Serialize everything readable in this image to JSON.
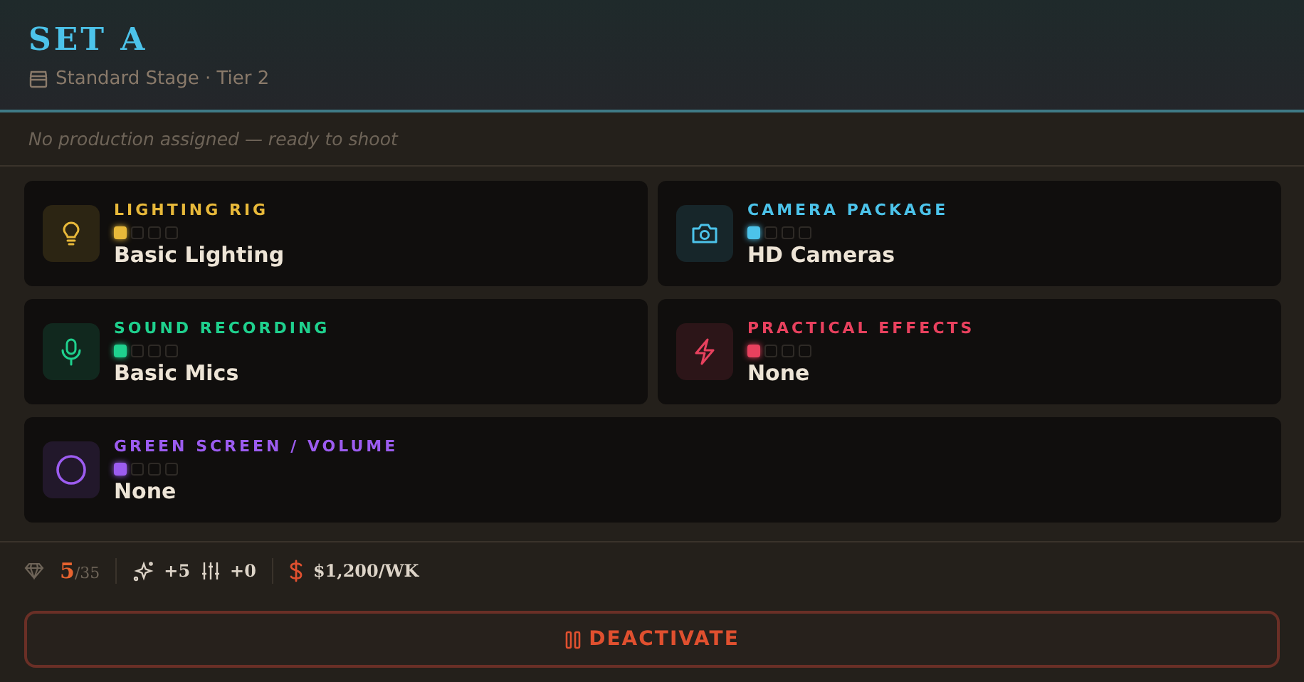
{
  "header": {
    "title": "SET A",
    "subtitle": "Standard Stage · Tier 2"
  },
  "status": "No production assigned — ready to shoot",
  "slots": [
    {
      "kind": "bulb",
      "label": "LIGHTING RIG",
      "value": "Basic Lighting",
      "stars": 1,
      "color": "#e8b93a"
    },
    {
      "kind": "camera",
      "label": "CAMERA PACKAGE",
      "value": "HD Cameras",
      "stars": 1,
      "color": "#4cc3ea"
    },
    {
      "kind": "mic",
      "label": "SOUND RECORDING",
      "value": "Basic Mics",
      "stars": 1,
      "color": "#1fd18e"
    },
    {
      "kind": "bolt",
      "label": "PRACTICAL EFFECTS",
      "value": "None",
      "stars": 1,
      "color": "#e8415e"
    },
    {
      "kind": "circle",
      "label": "GREEN SCREEN / VOLUME",
      "value": "None",
      "stars": 1,
      "color": "#9c5cf0"
    }
  ],
  "stats": {
    "quality": "5",
    "quality_max": "/35",
    "buzz": "+5",
    "craft": "+0",
    "cost": "$1,200/WK"
  },
  "button": "DEACTIVATE"
}
